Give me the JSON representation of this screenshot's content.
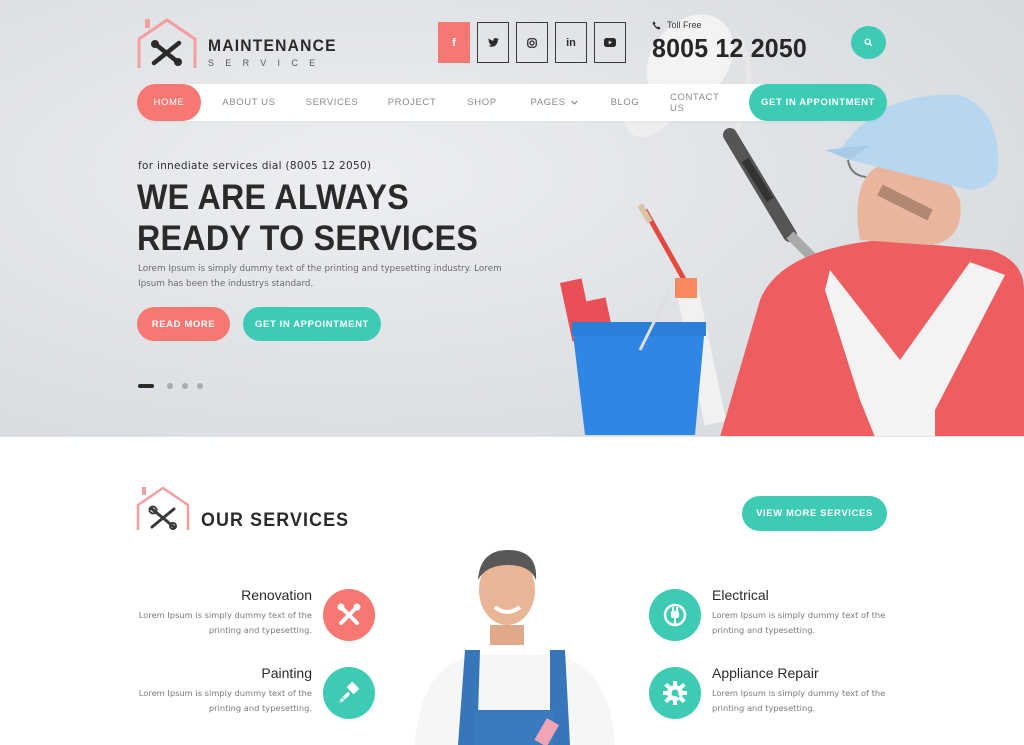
{
  "brand": {
    "name": "MAINTENANCE",
    "tagline": "SERVICE",
    "accent_coral": "#f77773",
    "accent_teal": "#3ecbb4"
  },
  "header": {
    "social": [
      {
        "name": "facebook",
        "glyph": "f"
      },
      {
        "name": "twitter",
        "glyph": ""
      },
      {
        "name": "instagram",
        "glyph": ""
      },
      {
        "name": "linkedin",
        "glyph": "in"
      },
      {
        "name": "youtube",
        "glyph": ""
      }
    ],
    "toll_label": "Toll Free",
    "toll_number": "8005 12 2050"
  },
  "nav": {
    "items": [
      {
        "label": "HOME",
        "active": true
      },
      {
        "label": "ABOUT US"
      },
      {
        "label": "SERVICES"
      },
      {
        "label": "PROJECT"
      },
      {
        "label": "SHOP"
      },
      {
        "label": "PAGES",
        "dropdown": true
      },
      {
        "label": "BLOG"
      },
      {
        "label": "CONTACT US"
      }
    ],
    "cta": "GET IN APPOINTMENT"
  },
  "hero": {
    "kicker": "for innediate services dial (8005 12 2050)",
    "title": "WE ARE ALWAYS READY TO SERVICES",
    "description": "Lorem Ipsum is simply dummy text of the printing and typesetting industry. Lorem Ipsum has been the industrys standard.",
    "read_more": "READ MORE",
    "appointment": "GET IN APPOINTMENT",
    "slides": 4,
    "active_slide": 1
  },
  "services": {
    "title": "OUR SERVICES",
    "view_more": "VIEW MORE SERVICES",
    "items": [
      {
        "title": "Renovation",
        "description": "Lorem Ipsum is simply dummy text of the printing and typesetting.",
        "icon": "tools-icon",
        "color": "coral",
        "side": "left"
      },
      {
        "title": "Painting",
        "description": "Lorem Ipsum is simply dummy text of the printing and typesetting.",
        "icon": "paint-brush-icon",
        "color": "teal",
        "side": "left"
      },
      {
        "title": "Electrical",
        "description": "Lorem Ipsum is simply dummy text of the printing and typesetting.",
        "icon": "plug-icon",
        "color": "teal",
        "side": "right"
      },
      {
        "title": "Appliance Repair",
        "description": "Lorem Ipsum is simply dummy text of the printing and typesetting.",
        "icon": "gear-wrench-icon",
        "color": "teal",
        "side": "right"
      }
    ]
  }
}
